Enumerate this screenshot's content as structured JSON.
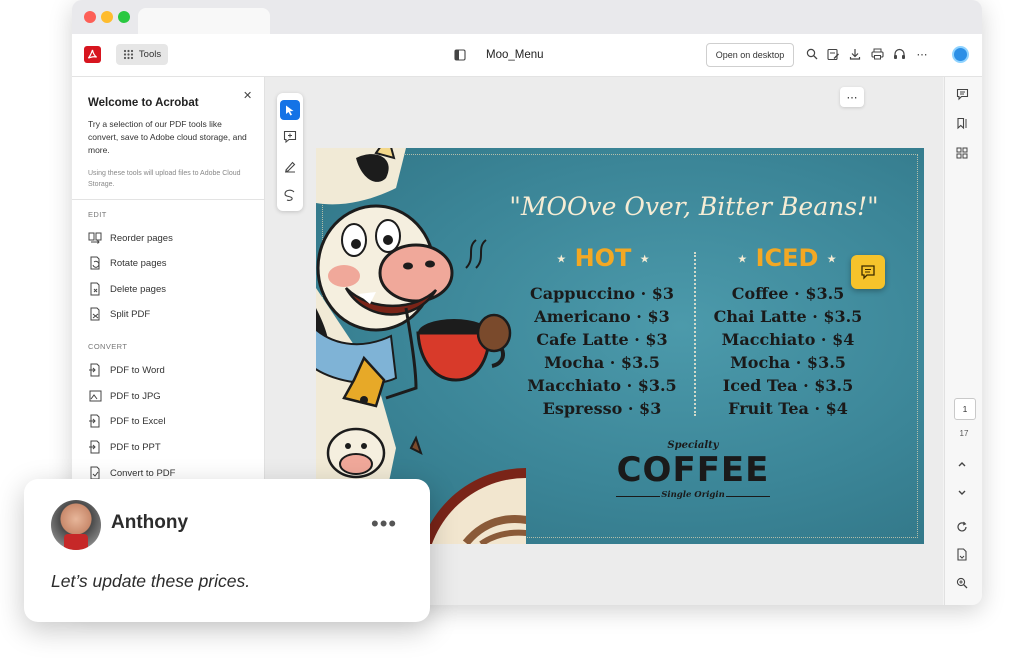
{
  "app": {
    "document_title": "Moo_Menu"
  },
  "toolbar": {
    "tools_label": "Tools",
    "open_desktop_label": "Open on desktop"
  },
  "welcome": {
    "title": "Welcome to Acrobat",
    "body": "Try a selection of our PDF tools like convert, save to Adobe cloud storage, and more.",
    "note": "Using these tools will upload files to Adobe Cloud Storage."
  },
  "sections": {
    "edit": {
      "label": "EDIT",
      "items": [
        {
          "label": "Reorder pages"
        },
        {
          "label": "Rotate pages"
        },
        {
          "label": "Delete pages"
        },
        {
          "label": "Split PDF"
        }
      ]
    },
    "convert": {
      "label": "CONVERT",
      "items": [
        {
          "label": "PDF to Word"
        },
        {
          "label": "PDF to JPG"
        },
        {
          "label": "PDF to Excel"
        },
        {
          "label": "PDF to PPT"
        },
        {
          "label": "Convert to PDF"
        }
      ]
    }
  },
  "menu": {
    "headline": "\"MOOve Over, Bitter Beans!\"",
    "hot_heading": "HOT",
    "iced_heading": "ICED",
    "hot_items": [
      "Cappuccino · $3",
      "Americano · $3",
      "Cafe Latte · $3",
      "Mocha · $3.5",
      "Macchiato · $3.5",
      "Espresso · $3"
    ],
    "iced_items": [
      "Coffee · $3.5",
      "Chai Latte · $3.5",
      "Macchiato · $4",
      "Mocha · $3.5",
      "Iced Tea · $3.5",
      "Fruit Tea · $4"
    ],
    "specialty": "Specialty",
    "coffee": "COFFEE",
    "single_origin": "Single Origin"
  },
  "pager": {
    "current_page": "1",
    "total_pages": "17"
  },
  "comment": {
    "author": "Anthony",
    "text": "Let’s update these prices."
  },
  "colors": {
    "acrobat_red": "#d7151f",
    "accent_blue": "#1473e6",
    "menu_teal": "#3d8a9b",
    "menu_orange": "#f3a823",
    "sticky_yellow": "#f6c32b"
  }
}
